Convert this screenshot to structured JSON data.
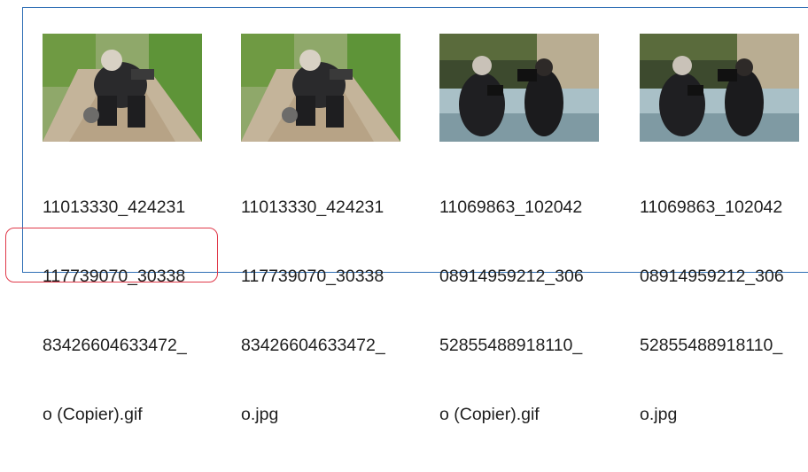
{
  "files": [
    {
      "name_lines": [
        "11013330_424231",
        "117739070_30338",
        "83426604633472_",
        "o (Copier).gif"
      ],
      "thumbnail": "photographer-crouching-path"
    },
    {
      "name_lines": [
        "11013330_424231",
        "117739070_30338",
        "83426604633472_",
        "o.jpg"
      ],
      "thumbnail": "photographer-crouching-path"
    },
    {
      "name_lines": [
        "11069863_102042",
        "08914959212_306",
        "52855488918110_",
        "o (Copier).gif"
      ],
      "thumbnail": "two-photographers-waterfall"
    },
    {
      "name_lines": [
        "11069863_102042",
        "08914959212_306",
        "52855488918110_",
        "o.jpg"
      ],
      "thumbnail": "two-photographers-waterfall"
    }
  ],
  "colors": {
    "frame_border": "#2f6fb5",
    "highlight_border": "#e0394a"
  }
}
